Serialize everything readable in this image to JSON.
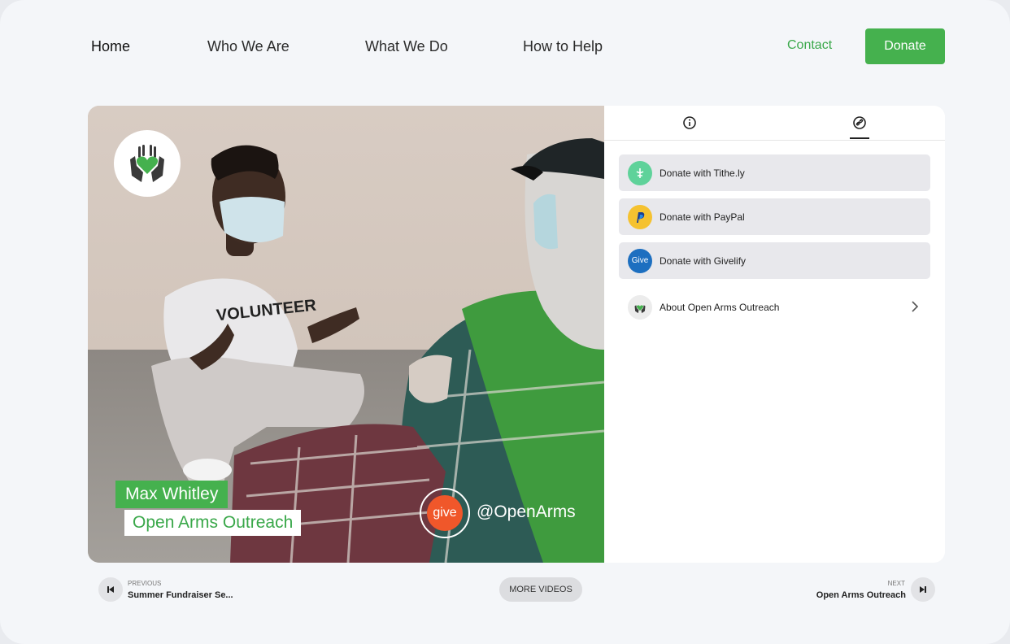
{
  "nav": {
    "items": [
      {
        "label": "Home",
        "active": true
      },
      {
        "label": "Who We Are"
      },
      {
        "label": "What We Do"
      },
      {
        "label": "How to Help"
      }
    ],
    "contact_label": "Contact",
    "donate_label": "Donate"
  },
  "video": {
    "overlay_name": "Max Whitley",
    "overlay_org": "Open Arms Outreach",
    "give_badge_text": "give",
    "handle": "@OpenArms",
    "shirt_text": "VOLUNTEER"
  },
  "panel": {
    "tabs": [
      {
        "icon": "info-icon"
      },
      {
        "icon": "link-icon",
        "active": true
      }
    ],
    "donate_options": [
      {
        "label": "Donate with Tithe.ly",
        "icon": "tithely-icon",
        "color": "#5fd29a"
      },
      {
        "label": "Donate with PayPal",
        "icon": "paypal-icon",
        "color": "#f5c230"
      },
      {
        "label": "Donate with Givelify",
        "icon": "givelify-icon",
        "color": "#1d6fc0",
        "icon_text": "Give"
      }
    ],
    "about_label": "About Open Arms Outreach"
  },
  "footer": {
    "previous_label": "PREVIOUS",
    "previous_title": "Summer Fundraiser Se...",
    "more_label": "MORE VIDEOS",
    "next_label": "NEXT",
    "next_title": "Open Arms Outreach"
  },
  "colors": {
    "accent": "#45b14e",
    "background": "#f4f6f9",
    "give_orange": "#f0572a"
  }
}
